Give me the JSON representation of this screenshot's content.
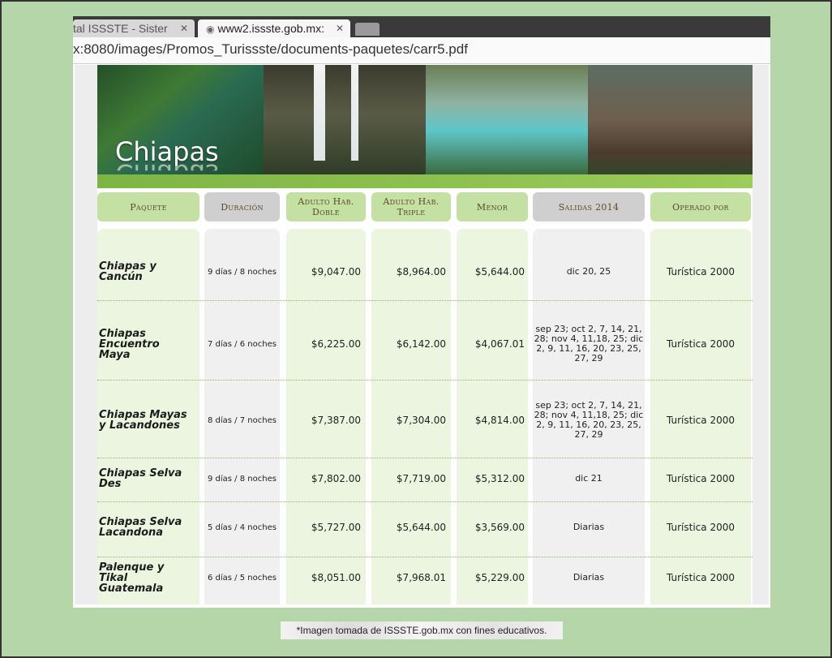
{
  "browser": {
    "tabs": [
      {
        "label": "tal ISSSTE - Sister"
      },
      {
        "label": "www2.issste.gob.mx:"
      }
    ],
    "url": "x:8080/images/Promos_Turissste/documents-paquetes/carr5.pdf"
  },
  "banner": {
    "title": "Chiapas"
  },
  "table": {
    "headers": {
      "paquete": "Paquete",
      "duracion": "Duración",
      "adulto_doble": "Adulto Hab. Doble",
      "adulto_triple": "Adulto Hab. Triple",
      "menor": "Menor",
      "salidas": "Salidas 2014",
      "operado": "Operado por"
    },
    "rows": [
      {
        "paquete": "Chiapas y Cancún",
        "duracion": "9 días / 8 noches",
        "doble": "$9,047.00",
        "triple": "$8,964.00",
        "menor": "$5,644.00",
        "salidas": "dic 20, 25",
        "operado": "Turística 2000"
      },
      {
        "paquete": "Chiapas Encuentro Maya",
        "duracion": "7 días / 6 noches",
        "doble": "$6,225.00",
        "triple": "$6,142.00",
        "menor": "$4,067.01",
        "salidas": "sep 23; oct 2, 7, 14, 21, 28; nov 4, 11,18, 25; dic 2, 9, 11, 16, 20, 23, 25, 27, 29",
        "operado": "Turística 2000"
      },
      {
        "paquete": "Chiapas Mayas y Lacandones",
        "duracion": "8 días / 7 noches",
        "doble": "$7,387.00",
        "triple": "$7,304.00",
        "menor": "$4,814.00",
        "salidas": "sep 23; oct 2, 7, 14, 21, 28; nov 4, 11,18, 25; dic 2, 9, 11, 16, 20, 23, 25, 27, 29",
        "operado": "Turística 2000"
      },
      {
        "paquete": "Chiapas Selva Des",
        "duracion": "9 días / 8 noches",
        "doble": "$7,802.00",
        "triple": "$7,719.00",
        "menor": "$5,312.00",
        "salidas": "dic 21",
        "operado": "Turística 2000"
      },
      {
        "paquete": "Chiapas Selva Lacandona",
        "duracion": "5 días / 4 noches",
        "doble": "$5,727.00",
        "triple": "$5,644.00",
        "menor": "$3,569.00",
        "salidas": "Diarias",
        "operado": "Turística 2000"
      },
      {
        "paquete": "Palenque y Tikal Guatemala",
        "duracion": "6 días / 5 noches",
        "doble": "$8,051.00",
        "triple": "$7,968.01",
        "menor": "$5,229.00",
        "salidas": "Diarias",
        "operado": "Turística 2000"
      }
    ]
  },
  "caption": "*Imagen tomada de ISSSTE.gob.mx con fines educativos."
}
